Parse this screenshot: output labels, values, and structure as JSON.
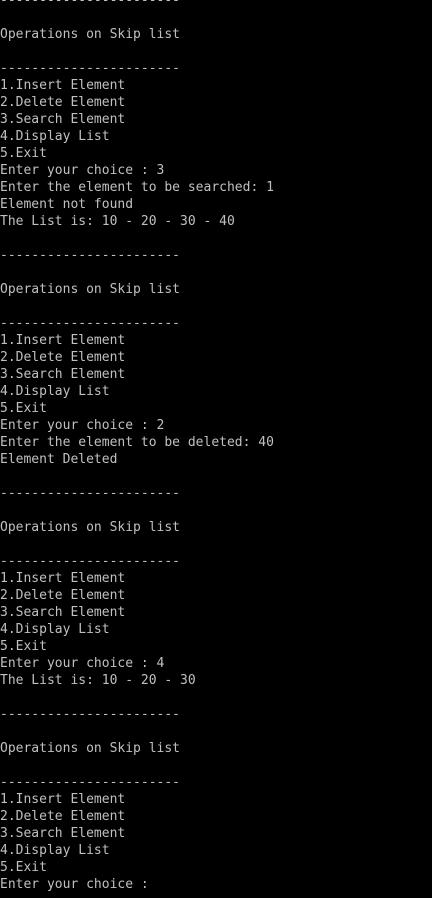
{
  "colors": {
    "background": "#000000",
    "text": "#c0c0c0"
  },
  "console": {
    "lines": [
      "-----------------------",
      "",
      "Operations on Skip list",
      "",
      "-----------------------",
      "1.Insert Element",
      "2.Delete Element",
      "3.Search Element",
      "4.Display List",
      "5.Exit",
      "Enter your choice : 3",
      "Enter the element to be searched: 1",
      "Element not found",
      "The List is: 10 - 20 - 30 - 40",
      "",
      "-----------------------",
      "",
      "Operations on Skip list",
      "",
      "-----------------------",
      "1.Insert Element",
      "2.Delete Element",
      "3.Search Element",
      "4.Display List",
      "5.Exit",
      "Enter your choice : 2",
      "Enter the element to be deleted: 40",
      "Element Deleted",
      "",
      "-----------------------",
      "",
      "Operations on Skip list",
      "",
      "-----------------------",
      "1.Insert Element",
      "2.Delete Element",
      "3.Search Element",
      "4.Display List",
      "5.Exit",
      "Enter your choice : 4",
      "The List is: 10 - 20 - 30",
      "",
      "-----------------------",
      "",
      "Operations on Skip list",
      "",
      "-----------------------",
      "1.Insert Element",
      "2.Delete Element",
      "3.Search Element",
      "4.Display List",
      "5.Exit",
      "Enter your choice : "
    ]
  }
}
